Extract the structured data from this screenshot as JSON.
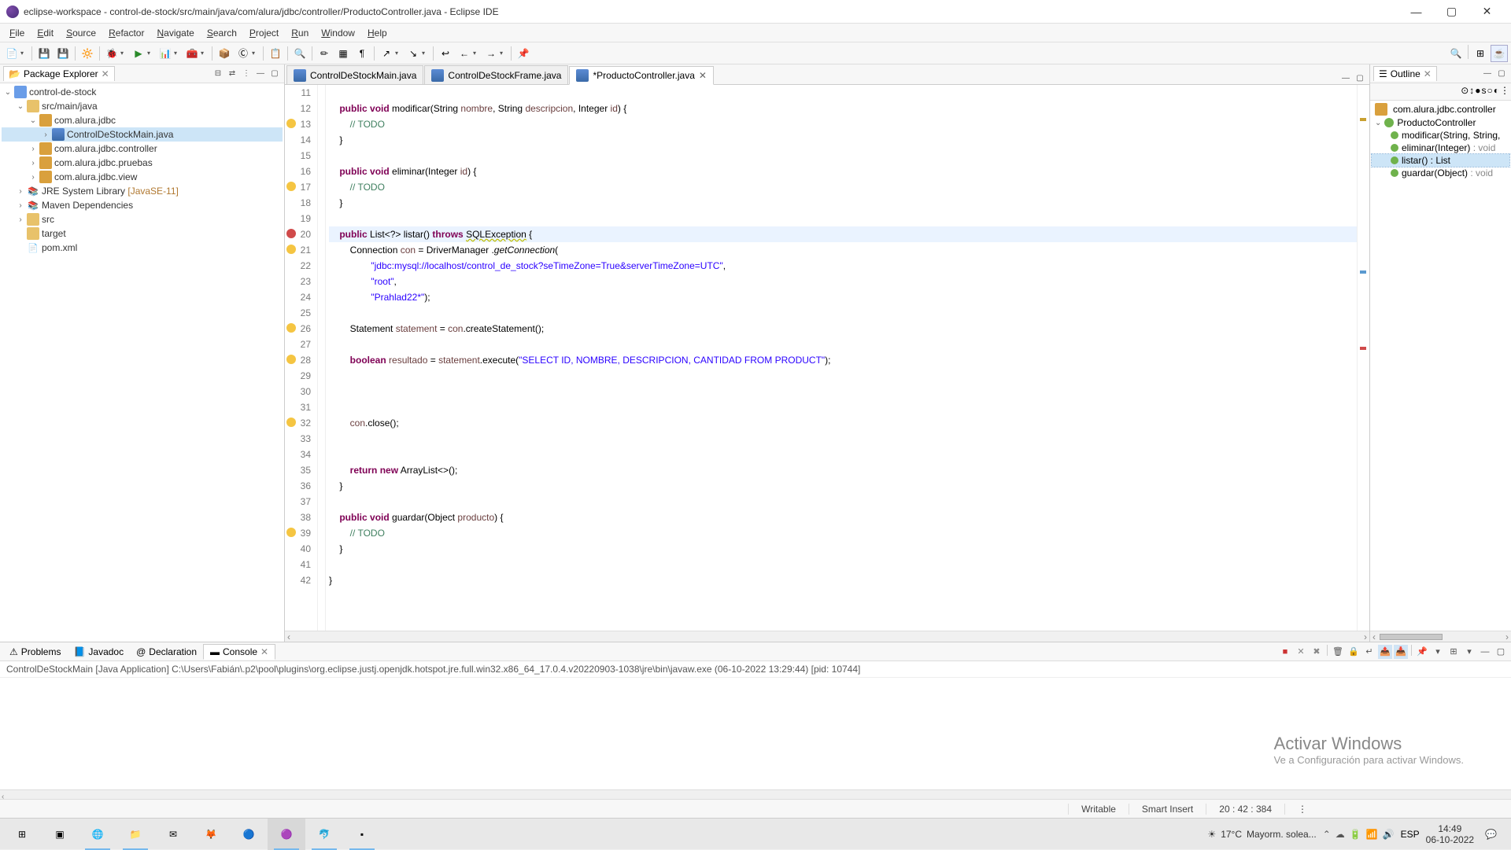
{
  "window": {
    "title": "eclipse-workspace - control-de-stock/src/main/java/com/alura/jdbc/controller/ProductoController.java - Eclipse IDE"
  },
  "menus": [
    "File",
    "Edit",
    "Source",
    "Refactor",
    "Navigate",
    "Search",
    "Project",
    "Run",
    "Window",
    "Help"
  ],
  "package_explorer": {
    "title": "Package Explorer",
    "project": "control-de-stock",
    "src_folder": "src/main/java",
    "packages": [
      {
        "name": "com.alura.jdbc",
        "children": [
          "ControlDeStockMain.java"
        ]
      },
      {
        "name": "com.alura.jdbc.controller"
      },
      {
        "name": "com.alura.jdbc.pruebas"
      },
      {
        "name": "com.alura.jdbc.view"
      }
    ],
    "jre": "JRE System Library",
    "jre_tag": "[JavaSE-11]",
    "maven": "Maven Dependencies",
    "src": "src",
    "target": "target",
    "pom": "pom.xml"
  },
  "editor": {
    "tabs": [
      {
        "label": "ControlDeStockMain.java",
        "dirty": false,
        "active": false
      },
      {
        "label": "ControlDeStockFrame.java",
        "dirty": false,
        "active": false
      },
      {
        "label": "*ProductoController.java",
        "dirty": true,
        "active": true
      }
    ],
    "lines": [
      {
        "n": 11,
        "html": ""
      },
      {
        "n": 12,
        "html": "    <span class='kw'>public</span> <span class='kw'>void</span> modificar(String <span class='par'>nombre</span>, String <span class='par'>descripcion</span>, Integer <span class='par'>id</span>) {"
      },
      {
        "n": 13,
        "html": "        <span class='cm'>// TODO</span>",
        "marker": "warn"
      },
      {
        "n": 14,
        "html": "    }"
      },
      {
        "n": 15,
        "html": ""
      },
      {
        "n": 16,
        "html": "    <span class='kw'>public</span> <span class='kw'>void</span> eliminar(Integer <span class='par'>id</span>) {"
      },
      {
        "n": 17,
        "html": "        <span class='cm'>// TODO</span>",
        "marker": "warn"
      },
      {
        "n": 18,
        "html": "    }"
      },
      {
        "n": 19,
        "html": ""
      },
      {
        "n": 20,
        "html": "    <span class='kw'>public</span> List&lt;?&gt; listar() <span class='kw'>throws</span> <span class='und'>SQLException</span> {",
        "hl": true,
        "marker": "err"
      },
      {
        "n": 21,
        "html": "        Connection <span class='var'>con</span> = DriverManager .<span class='mth'>getConnection</span>(",
        "marker": "warn"
      },
      {
        "n": 22,
        "html": "                <span class='str'>\"jdbc:mysql://localhost/control_de_stock?seTimeZone=True&amp;serverTimeZone=UTC\"</span>,"
      },
      {
        "n": 23,
        "html": "                <span class='str'>\"root\"</span>,"
      },
      {
        "n": 24,
        "html": "                <span class='str'>\"Prahlad22*\"</span>);"
      },
      {
        "n": 25,
        "html": ""
      },
      {
        "n": 26,
        "html": "        Statement <span class='var'>statement</span> = <span class='var'>con</span>.createStatement();",
        "marker": "warn"
      },
      {
        "n": 27,
        "html": ""
      },
      {
        "n": 28,
        "html": "        <span class='kw'>boolean</span> <span class='var'>resultado</span> = <span class='var'>statement</span>.execute(<span class='str'>\"SELECT ID, NOMBRE, DESCRIPCION, CANTIDAD FROM PRODUCT\"</span>);",
        "marker": "warn"
      },
      {
        "n": 29,
        "html": ""
      },
      {
        "n": 30,
        "html": ""
      },
      {
        "n": 31,
        "html": ""
      },
      {
        "n": 32,
        "html": "        <span class='var'>con</span>.close();",
        "marker": "warn"
      },
      {
        "n": 33,
        "html": ""
      },
      {
        "n": 34,
        "html": ""
      },
      {
        "n": 35,
        "html": "        <span class='kw'>return</span> <span class='kw'>new</span> ArrayList&lt;&gt;();"
      },
      {
        "n": 36,
        "html": "    }"
      },
      {
        "n": 37,
        "html": ""
      },
      {
        "n": 38,
        "html": "    <span class='kw'>public</span> <span class='kw'>void</span> guardar(Object <span class='par'>producto</span>) {"
      },
      {
        "n": 39,
        "html": "        <span class='cm'>// TODO</span>",
        "marker": "warn"
      },
      {
        "n": 40,
        "html": "    }"
      },
      {
        "n": 41,
        "html": ""
      },
      {
        "n": 42,
        "html": "}"
      }
    ]
  },
  "outline": {
    "title": "Outline",
    "package": "com.alura.jdbc.controller",
    "class_name": "ProductoController",
    "methods": [
      {
        "sig": "modificar(String, String,",
        "ret": ""
      },
      {
        "sig": "eliminar(Integer)",
        "ret": ": void"
      },
      {
        "sig": "listar() : List<?>",
        "ret": "",
        "sel": true
      },
      {
        "sig": "guardar(Object)",
        "ret": ": void"
      }
    ]
  },
  "console": {
    "tabs": [
      "Problems",
      "Javadoc",
      "Declaration",
      "Console"
    ],
    "active": 3,
    "launch": "ControlDeStockMain [Java Application] C:\\Users\\Fabián\\.p2\\pool\\plugins\\org.eclipse.justj.openjdk.hotspot.jre.full.win32.x86_64_17.0.4.v20220903-1038\\jre\\bin\\javaw.exe  (06-10-2022 13:29:44) [pid: 10744]"
  },
  "watermark": {
    "title": "Activar Windows",
    "sub": "Ve a Configuración para activar Windows."
  },
  "status": {
    "writable": "Writable",
    "insert": "Smart Insert",
    "pos": "20 : 42 : 384"
  },
  "taskbar": {
    "weather_temp": "17°C",
    "weather_desc": "Mayorm. solea...",
    "lang": "ESP",
    "time": "14:49",
    "date": "06-10-2022"
  }
}
